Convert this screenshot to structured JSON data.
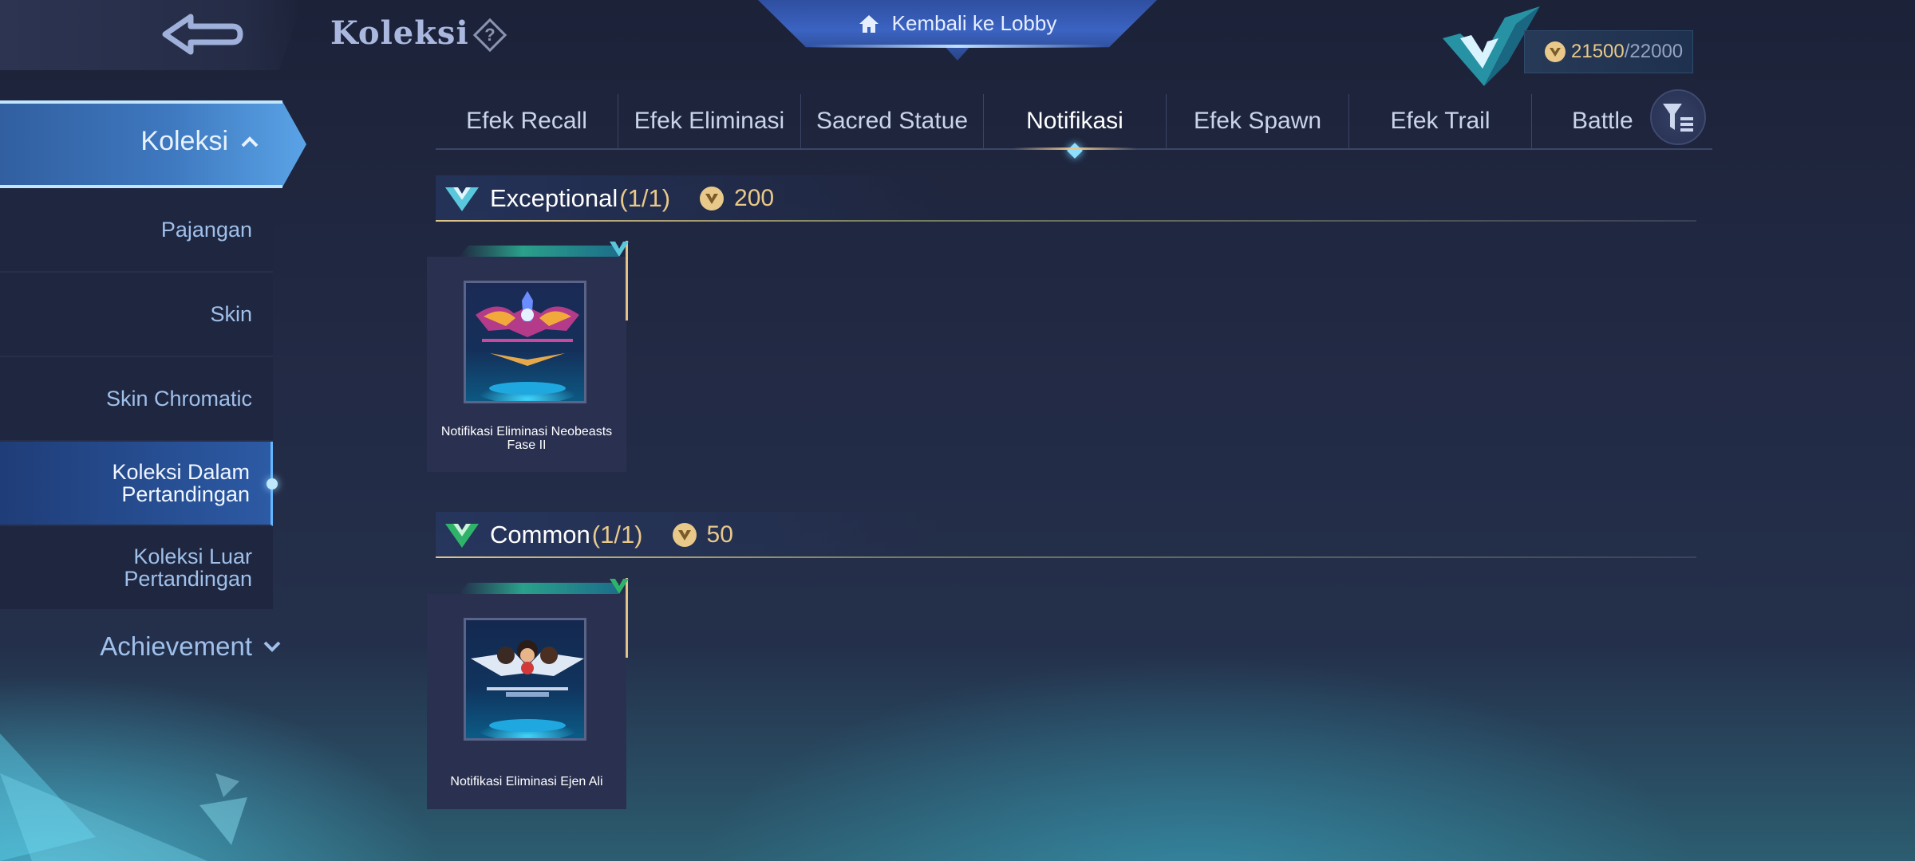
{
  "header": {
    "title": "Koleksi",
    "lobby_label": "Kembali ke Lobby",
    "points_value": "21500",
    "points_max": "/22000",
    "icons": [
      "back-arrow-icon",
      "help-icon",
      "home-icon",
      "rank-badge-icon",
      "coin-icon"
    ]
  },
  "sidebar": {
    "main_label": "Koleksi",
    "items": [
      {
        "label": "Pajangan"
      },
      {
        "label": "Skin"
      },
      {
        "label": "Skin Chromatic"
      },
      {
        "label": "Koleksi Dalam Pertandingan"
      },
      {
        "label": "Koleksi Luar Pertandingan"
      }
    ],
    "active_index": 3,
    "achievement_label": "Achievement"
  },
  "tabs": {
    "items": [
      "Efek Recall",
      "Efek Eliminasi",
      "Sacred Statue",
      "Notifikasi",
      "Efek Spawn",
      "Efek Trail",
      "Battle"
    ],
    "active_index": 3
  },
  "sections": [
    {
      "name": "Exceptional",
      "count": "(1/1)",
      "cost": "200",
      "items": [
        {
          "caption": "Notifikasi Eliminasi Neobeasts Fase II"
        }
      ]
    },
    {
      "name": "Common",
      "count": "(1/1)",
      "cost": "50",
      "items": [
        {
          "caption": "Notifikasi Eliminasi Ejen Ali"
        }
      ]
    }
  ],
  "colors": {
    "accent_gold": "#e9c98a",
    "accent_blue": "#3e78bf",
    "background": "#222a45"
  }
}
